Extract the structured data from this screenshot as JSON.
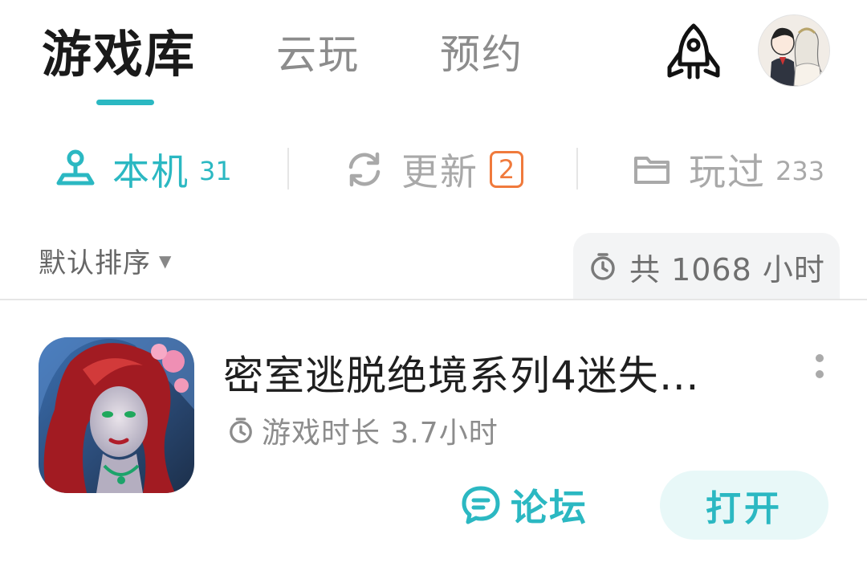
{
  "header": {
    "tabs": [
      "游戏库",
      "云玩",
      "预约"
    ],
    "active_tab": 0,
    "accent_color": "#2bb8c2",
    "rocket_icon": "rocket-icon",
    "avatar_icon": "user-avatar"
  },
  "subtabs": {
    "local": {
      "label": "本机",
      "count": "31",
      "icon": "local-device-icon"
    },
    "update": {
      "label": "更新",
      "badge": "2",
      "icon": "refresh-icon",
      "badge_color": "#f07a3c"
    },
    "played": {
      "label": "玩过",
      "count": "233",
      "icon": "folder-icon"
    }
  },
  "toolbar": {
    "sort_label": "默认排序",
    "total_time": "共 1068 小时"
  },
  "games": [
    {
      "title": "密室逃脱绝境系列4迷失…",
      "playtime": "游戏时长 3.7小时",
      "forum_label": "论坛",
      "open_label": "打开"
    }
  ]
}
